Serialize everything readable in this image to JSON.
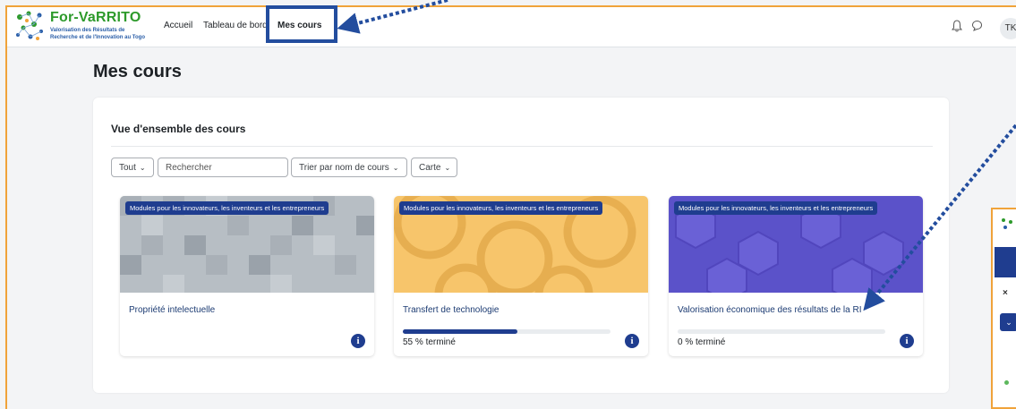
{
  "brand": {
    "title": "For-VaRRITO",
    "line1": "Valorisation des Résultats de",
    "line2": "Recherche et de l'Innovation au Togo"
  },
  "nav": {
    "home": "Accueil",
    "dashboard": "Tableau de bord",
    "courses": "Mes cours"
  },
  "user": {
    "initials": "TK"
  },
  "page": {
    "title": "Mes cours"
  },
  "overview": {
    "title": "Vue d'ensemble des cours",
    "filter": "Tout",
    "search_placeholder": "Rechercher",
    "sort": "Trier par nom de cours",
    "view": "Carte"
  },
  "courses": [
    {
      "category": "Modules pour les innovateurs, les inventeurs et les entrepreneurs",
      "name": "Propriété intelectuelle"
    },
    {
      "category": "Modules pour les innovateurs, les inventeurs et les entrepreneurs",
      "name": "Transfert de technologie",
      "progress": 55,
      "progress_label": "55 % terminé"
    },
    {
      "category": "Modules pour les innovateurs, les inventeurs et les entrepreneurs",
      "name": "Valorisation économique des résultats de la RI",
      "progress": 0,
      "progress_label": "0 % terminé"
    }
  ],
  "colors": {
    "accent": "#1f3d8f",
    "frame": "#f0a33a",
    "brand_green": "#2d9a2b"
  }
}
